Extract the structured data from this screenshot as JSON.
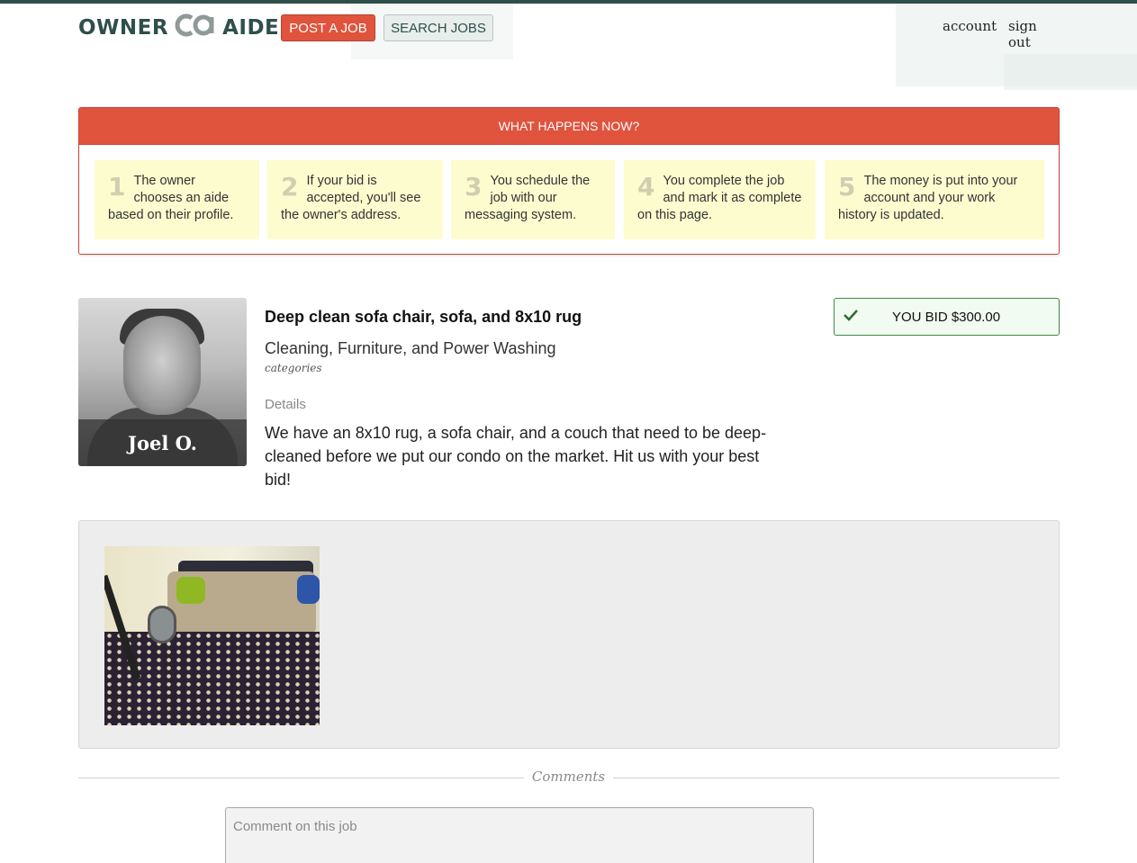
{
  "header": {
    "logo_left": "OWNER",
    "logo_right": "AIDE",
    "post_job_label": "POST A JOB",
    "search_jobs_label": "SEARCH JOBS",
    "account_label": "account",
    "sign_out_label": "sign out"
  },
  "steps": {
    "title": "WHAT HAPPENS NOW?",
    "items": [
      {
        "num": "1",
        "text": "The owner chooses an aide based on their profile."
      },
      {
        "num": "2",
        "text": "If your bid is accepted, you'll see the owner's address."
      },
      {
        "num": "3",
        "text": "You schedule the job with our messaging system."
      },
      {
        "num": "4",
        "text": "You complete the job and mark it as complete on this page."
      },
      {
        "num": "5",
        "text": "The money is put into your account and your work history is updated."
      }
    ]
  },
  "owner": {
    "name": "Joel O."
  },
  "job": {
    "title": "Deep clean sofa chair, sofa, and 8x10 rug",
    "categories": "Cleaning, Furniture, and Power Washing",
    "categories_label": "categories",
    "details_label": "Details",
    "details": "We have an 8x10 rug, a sofa chair, and a couch that need to be deep-cleaned before we put our condo on the market. Hit us with your best bid!"
  },
  "bid": {
    "label": "YOU BID $300.00",
    "icon": "check-icon"
  },
  "comments": {
    "section_label": "Comments",
    "placeholder": "Comment on this job"
  },
  "colors": {
    "brand_dark": "#2f4f4a",
    "accent_red": "#e0533d",
    "step_bg": "#fdfccf",
    "bid_green": "#3a8a45"
  }
}
